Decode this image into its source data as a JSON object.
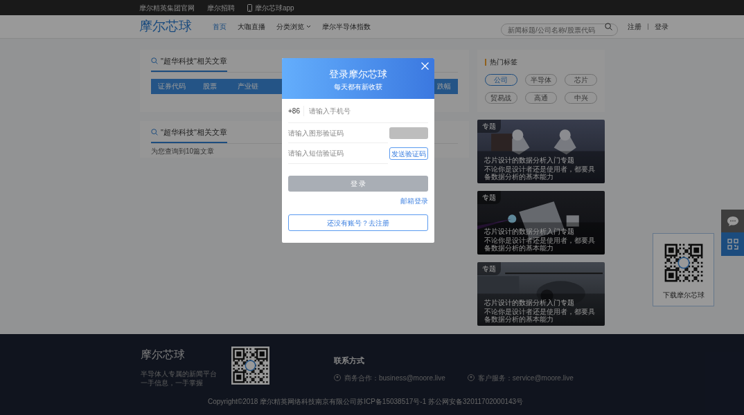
{
  "top_bar": {
    "links": [
      {
        "label": "摩尔精英集团官网",
        "kind": "text"
      },
      {
        "label": "摩尔招聘",
        "kind": "text"
      },
      {
        "label": "摩尔芯球app",
        "kind": "app"
      }
    ]
  },
  "header": {
    "logo": "摩尔芯球",
    "nav": [
      {
        "label": "首页",
        "selected": true,
        "dropdown": false
      },
      {
        "label": "大咖直播",
        "selected": false,
        "dropdown": false
      },
      {
        "label": "分类浏览",
        "selected": false,
        "dropdown": true
      },
      {
        "label": "摩尔半导体指数",
        "selected": false,
        "dropdown": false
      }
    ],
    "search": {
      "placeholder": "新闻标题/公司名称/股票代码"
    },
    "auth": [
      "注册",
      "登录"
    ]
  },
  "sections": [
    {
      "title": "\"超华科技\"相关文章",
      "columns": [
        "证券代码",
        "股票",
        "产业链",
        "跌幅"
      ]
    },
    {
      "title": "\"超华科技\"相关文章",
      "note": "为您查询到10篇文章"
    }
  ],
  "hot_tags": {
    "title": "热门标签",
    "tags": [
      {
        "label": "公司",
        "selected": true
      },
      {
        "label": "半导体",
        "selected": false
      },
      {
        "label": "芯片",
        "selected": false
      },
      {
        "label": "贸易战",
        "selected": false
      },
      {
        "label": "高通",
        "selected": false
      },
      {
        "label": "中兴",
        "selected": false
      }
    ]
  },
  "topics": [
    {
      "badge": "专题",
      "title": "芯片设计的数据分析入门专题",
      "desc": "不论你是设计者还是使用者，都要具备数据分析的基本能力"
    },
    {
      "badge": "专题",
      "title": "芯片设计的数据分析入门专题",
      "desc": "不论你是设计者还是使用者，都要具备数据分析的基本能力"
    },
    {
      "badge": "专题",
      "title": "芯片设计的数据分析入门专题",
      "desc": "不论你是设计者还是使用者，都要具备数据分析的基本能力"
    }
  ],
  "side_widget": {
    "qr_caption": "下载摩尔芯球"
  },
  "footer": {
    "brand": "摩尔芯球",
    "slogan": [
      "半导体人专属的新闻平台",
      "一手信息，一手掌握"
    ],
    "contact_title": "联系方式",
    "contacts": [
      "商务合作：business@moore.live",
      "客户服务：service@moore.live"
    ],
    "copyright": "Copyright©2018 摩尔精英网络科技南京有限公司苏ICP备15038517号-1 苏公网安备32011702000143号"
  },
  "modal": {
    "title": "登录摩尔芯球",
    "subtitle": "每天都有新收获",
    "country_code": "+86",
    "phone_placeholder": "请输入手机号",
    "captcha_placeholder": "请输入图形验证码",
    "sms_placeholder": "请输入短信验证码",
    "send_code": "发送验证码",
    "login": {
      "label": "登 录",
      "disabled": true
    },
    "email_login": "邮箱登录",
    "register": "还没有账号？去注册"
  }
}
